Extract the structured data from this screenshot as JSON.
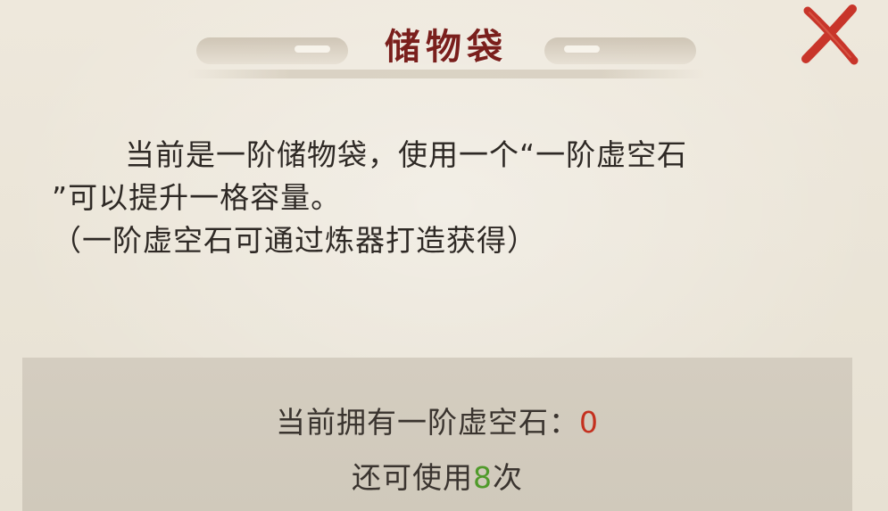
{
  "title": "储物袋",
  "close_icon": "close-x-icon",
  "description": {
    "line1": "当前是一阶储物袋，使用一个“一阶虚空石",
    "line2": "”可以提升一格容量。",
    "line3": "（一阶虚空石可通过炼器打造获得）"
  },
  "info": {
    "owned_label": "当前拥有一阶虚空石：",
    "owned_count": "0",
    "remaining_prefix": "还可使用",
    "remaining_count": "8",
    "remaining_suffix": "次"
  },
  "colors": {
    "title": "#7a1f1c",
    "close": "#c8352a",
    "owned_count": "#c4301f",
    "remaining_count": "#4f9a2a"
  }
}
